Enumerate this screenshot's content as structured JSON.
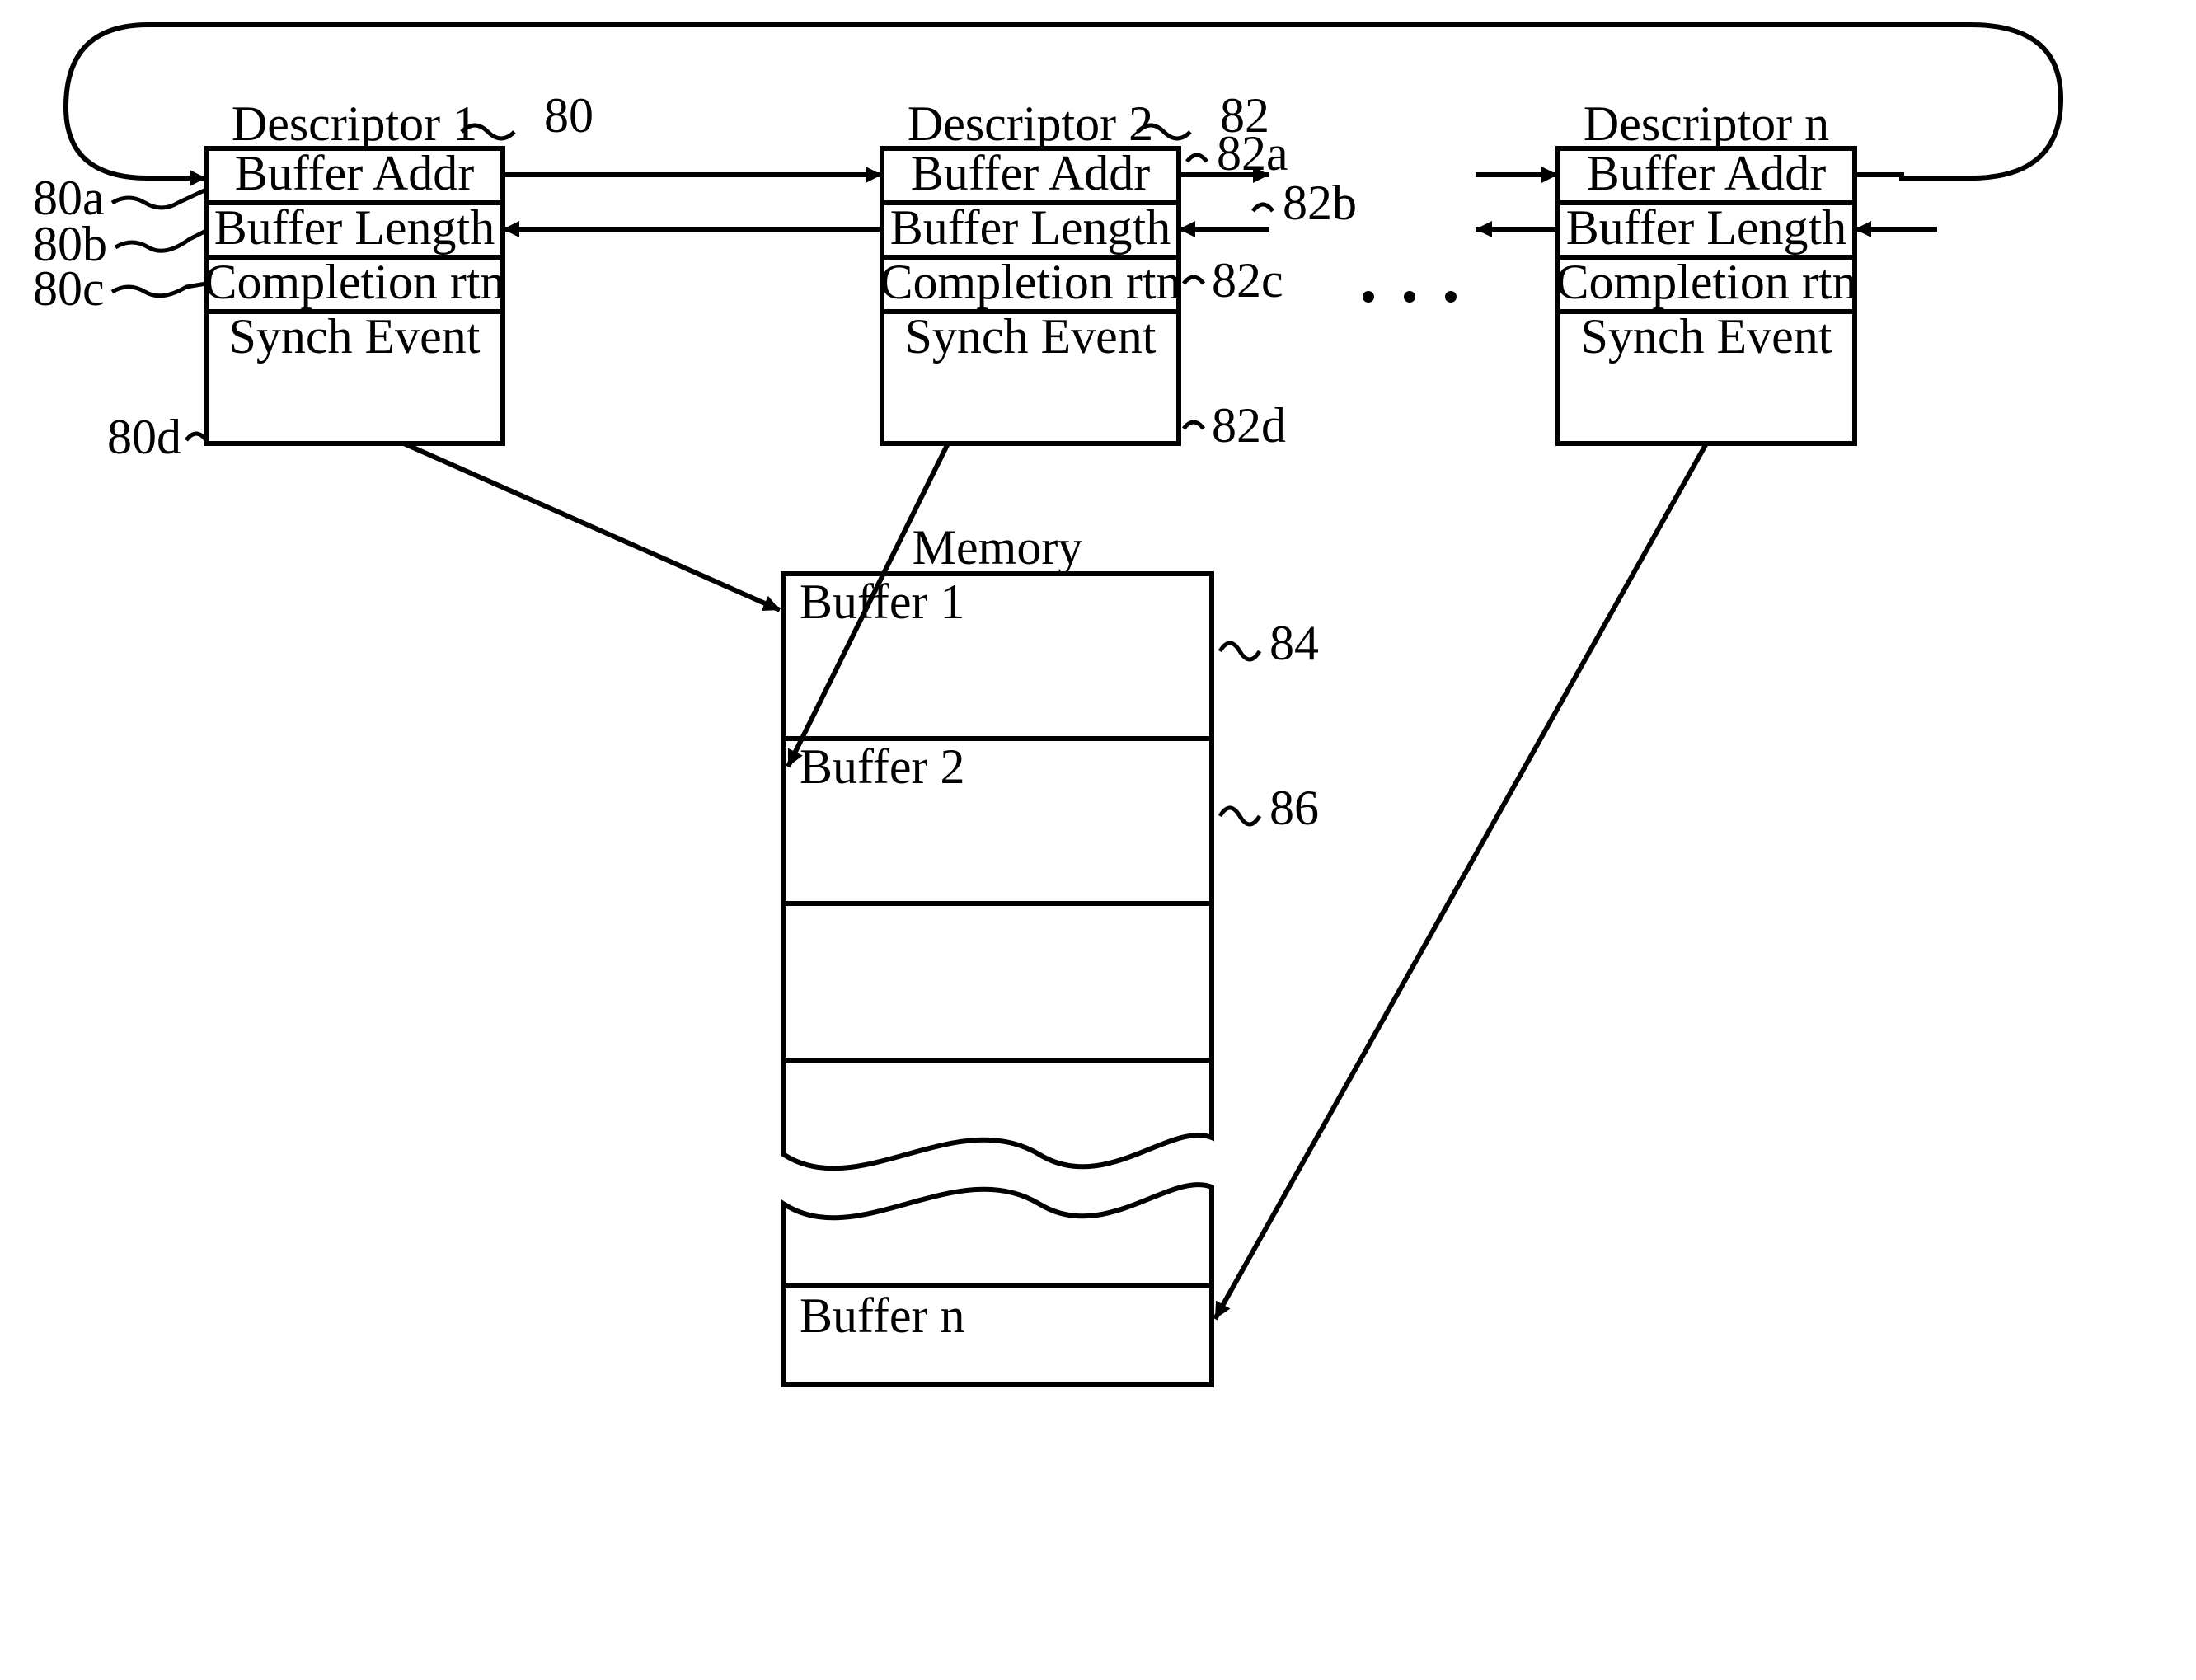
{
  "descriptors": [
    {
      "title": "Descriptor 1",
      "rows": [
        "Buffer Addr",
        "Buffer Length",
        "Completion rtn",
        "Synch Event"
      ]
    },
    {
      "title": "Descriptor 2",
      "rows": [
        "Buffer Addr",
        "Buffer Length",
        "Completion rtn",
        "Synch Event"
      ]
    },
    {
      "title": "Descriptor n",
      "rows": [
        "Buffer Addr",
        "Buffer Length",
        "Completion rtn",
        "Synch Event"
      ]
    }
  ],
  "memory": {
    "title": "Memory",
    "buffers": [
      "Buffer 1",
      "Buffer 2",
      "Buffer n"
    ]
  },
  "refs": {
    "d80": "80",
    "d82": "82",
    "r80a": "80a",
    "r80b": "80b",
    "r80c": "80c",
    "r80d": "80d",
    "r82a": "82a",
    "r82b": "82b",
    "r82c": "82c",
    "r82d": "82d",
    "m84": "84",
    "m86": "86"
  },
  "ellipsis": "…"
}
